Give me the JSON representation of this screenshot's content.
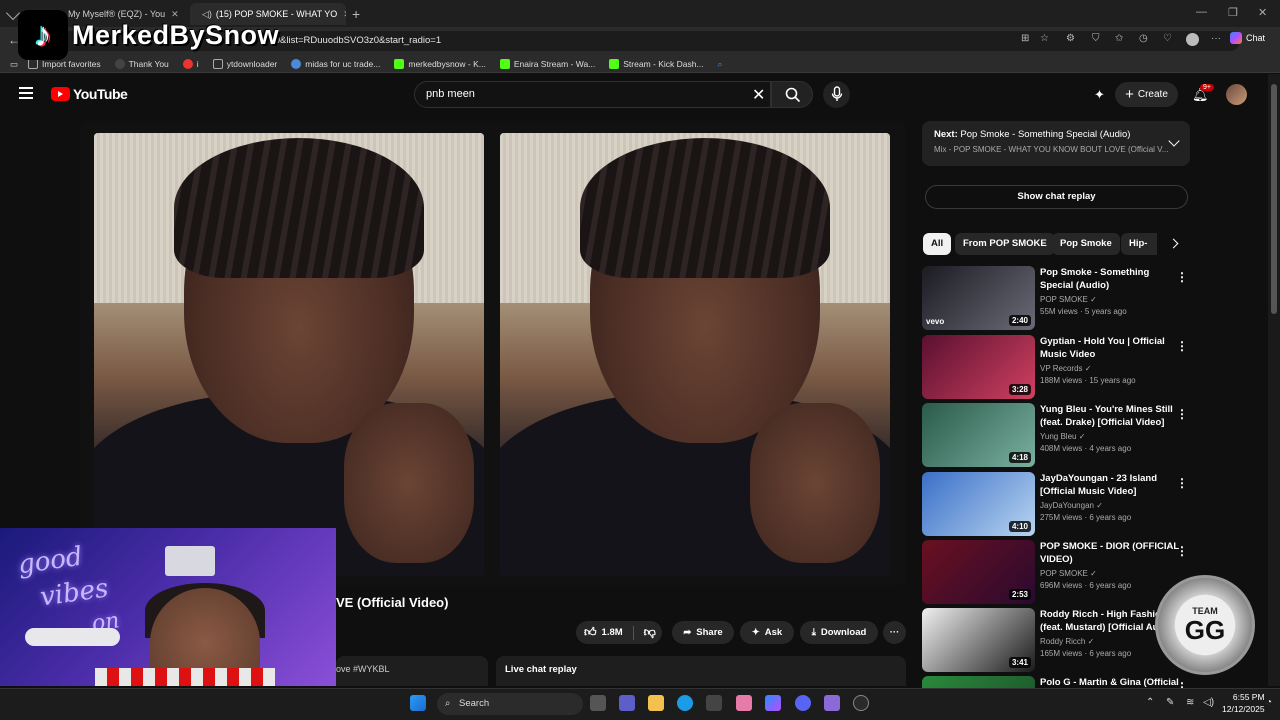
{
  "browser": {
    "tabs": [
      {
        "label": "My Myself® (EQZ) - You",
        "active": false
      },
      {
        "label": "(15) POP SMOKE - WHAT YO",
        "active": true
      }
    ],
    "url": "z0&list=RDuuodbSVO3z0&start_radio=1",
    "chat_label": "Chat",
    "bookmarks": [
      "Import favorites",
      "Thank You",
      "i",
      "ytdownloader",
      "midas for uc trade...",
      "merkedbysnow - K...",
      "Enaira Stream - Wa...",
      "Stream - Kick Dash..."
    ]
  },
  "overlay": {
    "tiktok_name": "MerkedBySnow"
  },
  "youtube": {
    "logo_text": "YouTube",
    "search_value": "pnb meen",
    "create_label": "Create",
    "notif_badge": "9+"
  },
  "video": {
    "title_partial": "VE (Official Video)",
    "likes": "1.8M",
    "share_label": "Share",
    "ask_label": "Ask",
    "download_label": "Download",
    "tag_partial": "ove #WYKBL",
    "live_chat_label": "Live chat replay"
  },
  "sidebar": {
    "next_prefix": "Next:",
    "next_title": "Pop Smoke - Something Special (Audio)",
    "next_sub": "Mix - POP SMOKE - WHAT YOU KNOW BOUT LOVE (Official V...",
    "show_chat": "Show chat replay",
    "chips": [
      "All",
      "From POP SMOKE",
      "Pop Smoke",
      "Hip-ho"
    ],
    "recs": [
      {
        "title": "Pop Smoke - Something Special (Audio)",
        "channel": "POP SMOKE",
        "meta": "55M views · 5 years ago",
        "dur": "2:40",
        "c1": "#1b1b22",
        "c2": "#6b6b78"
      },
      {
        "title": "Gyptian - Hold You | Official Music Video",
        "channel": "VP Records",
        "meta": "188M views · 15 years ago",
        "dur": "3:28",
        "c1": "#5a1030",
        "c2": "#d04060"
      },
      {
        "title": "Yung Bleu - You're Mines Still (feat. Drake) [Official Video]",
        "channel": "Yung Bleu",
        "meta": "408M views · 4 years ago",
        "dur": "4:18",
        "c1": "#2a5a4a",
        "c2": "#7ab0a0"
      },
      {
        "title": "JayDaYoungan - 23 Island [Official Music Video]",
        "channel": "JayDaYoungan",
        "meta": "275M views · 6 years ago",
        "dur": "4:10",
        "c1": "#3a70c8",
        "c2": "#b8d4f0"
      },
      {
        "title": "POP SMOKE - DIOR (OFFICIAL VIDEO)",
        "channel": "POP SMOKE",
        "meta": "696M views · 6 years ago",
        "dur": "2:53",
        "c1": "#6a1020",
        "c2": "#2a0a30"
      },
      {
        "title": "Roddy Ricch - High Fashion (feat. Mustard) [Official Aud",
        "channel": "Roddy Ricch",
        "meta": "165M views · 6 years ago",
        "dur": "3:41",
        "c1": "#f0f0f0",
        "c2": "#1a1a1a"
      },
      {
        "title": "Polo G - Martin & Gina (Official",
        "channel": "",
        "meta": "",
        "dur": "",
        "c1": "#2a8a3a",
        "c2": "#1a4a2a"
      }
    ]
  },
  "cam": {
    "neon_1": "good",
    "neon_2": "vibes",
    "neon_3": "on"
  },
  "badge_team": {
    "top": "TEAM",
    "main": "GG"
  },
  "taskbar": {
    "search_label": "Search",
    "time": "6:55 PM",
    "date": "12/12/2025"
  }
}
